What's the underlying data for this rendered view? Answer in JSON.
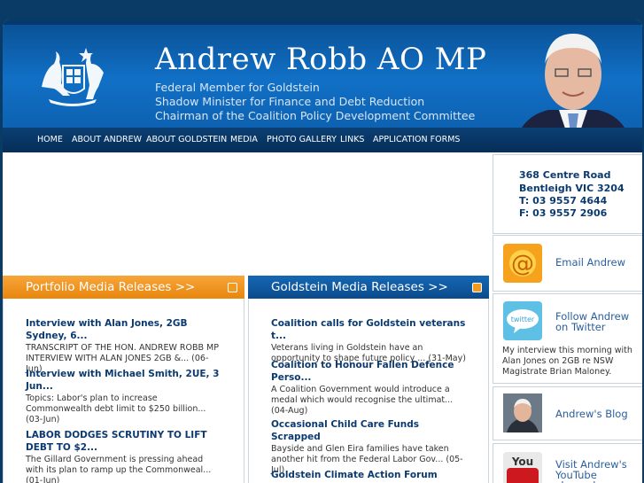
{
  "header": {
    "name": "Andrew Robb AO MP",
    "subtitles": [
      "Federal Member for Goldstein",
      "Shadow Minister for Finance and Debt Reduction",
      "Chairman of the Coalition Policy Development Committee"
    ]
  },
  "nav": [
    "HOME",
    "ABOUT ANDREW",
    "ABOUT GOLDSTEIN",
    "MEDIA",
    "PHOTO GALLERY",
    "LINKS",
    "APPLICATION FORMS"
  ],
  "address": {
    "line1": "368 Centre Road",
    "line2": "Bentleigh VIC 3204",
    "phone": "T: 03 9557 4644",
    "fax": "F: 03 9557 2906"
  },
  "portfolio": {
    "title": "Portfolio Media Releases >>",
    "items": [
      {
        "title": "Interview with Alan Jones, 2GB Sydney, 6...",
        "text": "TRANSCRIPT OF THE HON. ANDREW ROBB MP INTERVIEW WITH ALAN JONES 2GB &... (06-Jun)"
      },
      {
        "title": "Interview with Michael Smith, 2UE, 3 Jun...",
        "text": "Topics: Labor's plan to increase Commonwealth debt limit to $250 billion... (03-Jun)"
      },
      {
        "title": "LABOR DODGES SCRUTINY TO LIFT DEBT TO $2...",
        "text": "The Gillard Government is pressing ahead with its plan to ramp up the Commonweal... (01-Jun)"
      }
    ]
  },
  "goldstein": {
    "title": "Goldstein Media Releases >>",
    "items": [
      {
        "title": "Coalition calls for Goldstein veterans t...",
        "text": "Veterans living in Goldstein have an opportunity to shape future policy ... (31-May)"
      },
      {
        "title": "Coalition to Honour Fallen Defence Perso...",
        "text": "A Coalition Government would introduce a medal which would recognise the ultimat... (04-Aug)"
      },
      {
        "title": "Occasional Child Care Funds Scrapped",
        "text": "Bayside and Glen Eira families have taken another hit from the Federal Labor Gov... (05-Jul)"
      },
      {
        "title": "Goldstein Climate Action Forum",
        "text": ""
      }
    ]
  },
  "sidebar": {
    "email": "Email Andrew",
    "twitter": "Follow Andrew on Twitter",
    "twitter_icon_text": "twitter",
    "tweet": "My interview this morning with Alan Jones on 2GB re NSW Magistrate Brian Maloney.",
    "blog": "Andrew's Blog",
    "youtube": "Visit Andrew's YouTube channel",
    "youtube_icon_text": "You"
  },
  "colors": {
    "header_blue": "#1170c6",
    "nav_dark": "#062e58",
    "orange": "#f39a1e",
    "navy": "#0b3a70"
  }
}
